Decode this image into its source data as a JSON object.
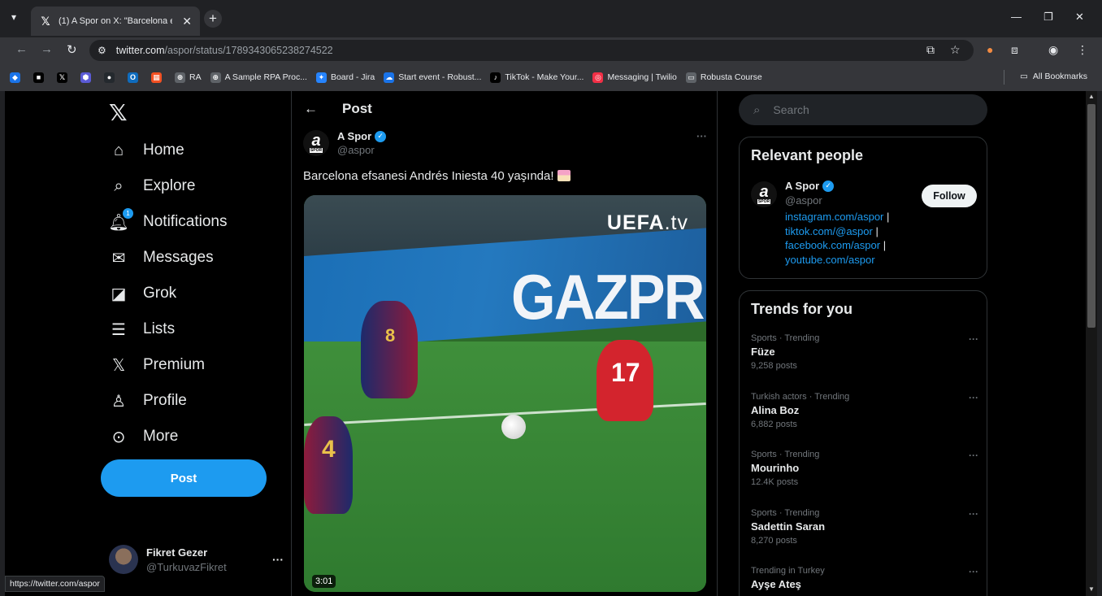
{
  "browser": {
    "tab_title": "(1) A Spor on X: \"Barcelona efsa",
    "url_host": "twitter.com",
    "url_path": "/aspor/status/1789343065238274522",
    "status_url": "https://twitter.com/aspor",
    "bookmarks": [
      {
        "label": "",
        "icon": "diamond-icon",
        "color": "#1a73e8"
      },
      {
        "label": "",
        "icon": "square-icon",
        "color": "#000000"
      },
      {
        "label": "",
        "icon": "x-icon",
        "color": "#000000"
      },
      {
        "label": "",
        "icon": "hex-icon",
        "color": "#5b5bd6"
      },
      {
        "label": "",
        "icon": "github-icon",
        "color": "#24292e"
      },
      {
        "label": "",
        "icon": "outlook-icon",
        "color": "#0f6cbd"
      },
      {
        "label": "",
        "icon": "grid-icon",
        "color": "#f25022"
      },
      {
        "label": "RA",
        "icon": "globe-icon",
        "color": "#5f6368"
      },
      {
        "label": "A Sample RPA Proc...",
        "icon": "globe-icon",
        "color": "#5f6368"
      },
      {
        "label": "Board - Jira",
        "icon": "jira-icon",
        "color": "#2684ff"
      },
      {
        "label": "Start event - Robust...",
        "icon": "cloud-icon",
        "color": "#1a73e8"
      },
      {
        "label": "TikTok - Make Your...",
        "icon": "tiktok-icon",
        "color": "#000000"
      },
      {
        "label": "Messaging | Twilio",
        "icon": "twilio-icon",
        "color": "#f22f46"
      },
      {
        "label": "Robusta Course",
        "icon": "folder-icon",
        "color": "#5f6368"
      }
    ],
    "all_bookmarks": "All Bookmarks"
  },
  "nav": {
    "items": [
      {
        "label": "Home",
        "icon": "home-icon"
      },
      {
        "label": "Explore",
        "icon": "search-icon"
      },
      {
        "label": "Notifications",
        "icon": "bell-icon",
        "badge": "1"
      },
      {
        "label": "Messages",
        "icon": "mail-icon"
      },
      {
        "label": "Grok",
        "icon": "grok-icon"
      },
      {
        "label": "Lists",
        "icon": "list-icon"
      },
      {
        "label": "Premium",
        "icon": "x-logo-icon"
      },
      {
        "label": "Profile",
        "icon": "person-icon"
      },
      {
        "label": "More",
        "icon": "more-circle-icon"
      }
    ],
    "post_button": "Post",
    "account": {
      "name": "Fikret Gezer",
      "handle": "@TurkuvazFikret"
    }
  },
  "main": {
    "header_title": "Post",
    "tweet": {
      "author_name": "A Spor",
      "author_handle": "@aspor",
      "text": "Barcelona efsanesi Andrés Iniesta 40 yaşında!",
      "video_logo": "UEFA",
      "video_logo_suffix": ".tv",
      "video_brand_text": "GAZPR",
      "jersey_numbers": [
        "8",
        "17",
        "4"
      ],
      "video_duration": "3:01"
    }
  },
  "sidebar": {
    "search_placeholder": "Search",
    "relevant_people": {
      "title": "Relevant people",
      "name": "A Spor",
      "handle": "@aspor",
      "follow_label": "Follow",
      "links": [
        "instagram.com/aspor",
        "tiktok.com/@aspor",
        "facebook.com/aspor",
        "youtube.com/aspor"
      ]
    },
    "trends": {
      "title": "Trends for you",
      "items": [
        {
          "meta": "Sports · Trending",
          "name": "Füze",
          "count": "9,258 posts"
        },
        {
          "meta": "Turkish actors · Trending",
          "name": "Alina Boz",
          "count": "6,882 posts"
        },
        {
          "meta": "Sports · Trending",
          "name": "Mourinho",
          "count": "12.4K posts"
        },
        {
          "meta": "Sports · Trending",
          "name": "Sadettin Saran",
          "count": "8,270 posts"
        },
        {
          "meta": "Trending in Turkey",
          "name": "Ayşe Ateş",
          "count": ""
        }
      ]
    }
  },
  "colors": {
    "accent": "#1d9bf0",
    "background": "#000000",
    "chrome": "#35363a"
  }
}
